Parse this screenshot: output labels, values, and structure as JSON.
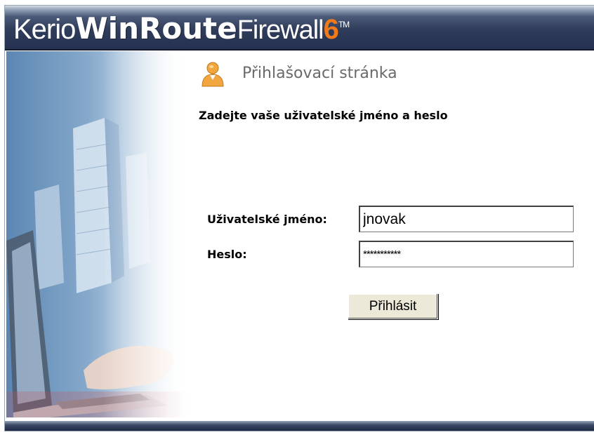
{
  "header": {
    "logo_kerio": "Kerio",
    "logo_winroute": "WinRoute",
    "logo_firewall": "Firewall",
    "logo_version": "6",
    "logo_tm": "TM"
  },
  "login": {
    "title": "Přihlašovací stránka",
    "subtitle": "Zadejte vaše uživatelské jméno a heslo",
    "username_label": "Uživatelské jméno:",
    "username_value": "jnovak",
    "password_label": "Heslo:",
    "password_value": "***********",
    "submit_label": "Přihlásit"
  },
  "colors": {
    "header_bg": "#2f3c5a",
    "version_accent": "#f07a1a",
    "button_bg": "#ece9d8"
  },
  "icons": {
    "user": "user-icon"
  }
}
